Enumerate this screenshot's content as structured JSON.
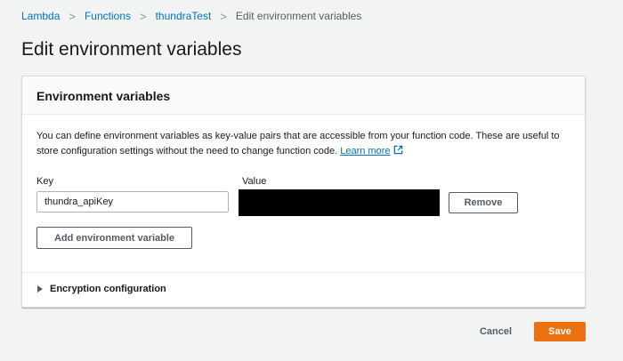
{
  "breadcrumb": {
    "items": [
      "Lambda",
      "Functions",
      "thundraTest"
    ],
    "current": "Edit environment variables"
  },
  "page_title": "Edit environment variables",
  "panel": {
    "title": "Environment variables",
    "description": "You can define environment variables as key-value pairs that are accessible from your function code. These are useful to store configuration settings without the need to change function code.",
    "learn_more": "Learn more",
    "key_label": "Key",
    "value_label": "Value",
    "variables": [
      {
        "key": "thundra_apiKey",
        "value_redacted": true
      }
    ],
    "remove_label": "Remove",
    "add_label": "Add environment variable",
    "encryption_label": "Encryption configuration"
  },
  "footer": {
    "cancel_label": "Cancel",
    "save_label": "Save"
  },
  "colors": {
    "link": "#0073bb",
    "primary": "#ec7211",
    "background": "#f2f3f3"
  }
}
